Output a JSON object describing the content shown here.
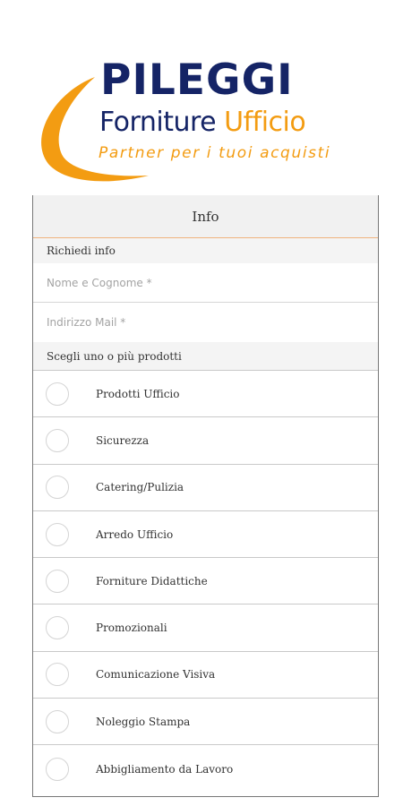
{
  "logo": {
    "title": "PILEGGI",
    "subtitle_part1": "Forniture ",
    "subtitle_part2": "Ufficio",
    "tagline": "Partner per i tuoi acquisti",
    "colors": {
      "navy": "#152466",
      "orange": "#f39c12"
    }
  },
  "header": {
    "title": "Info"
  },
  "form": {
    "section_title": "Richiedi info",
    "name_placeholder": "Nome e Cognome *",
    "email_placeholder": "Indirizzo Mail *",
    "products_title": "Scegli uno o più prodotti",
    "options": [
      {
        "label": "Prodotti Ufficio",
        "selected": false
      },
      {
        "label": "Sicurezza",
        "selected": false
      },
      {
        "label": "Catering/Pulizia",
        "selected": false
      },
      {
        "label": "Arredo Ufficio",
        "selected": false
      },
      {
        "label": "Forniture Didattiche",
        "selected": false
      },
      {
        "label": "Promozionali",
        "selected": false
      },
      {
        "label": "Comunicazione Visiva",
        "selected": false
      },
      {
        "label": "Noleggio Stampa",
        "selected": false
      },
      {
        "label": "Abbigliamento da Lavoro",
        "selected": false
      }
    ]
  }
}
